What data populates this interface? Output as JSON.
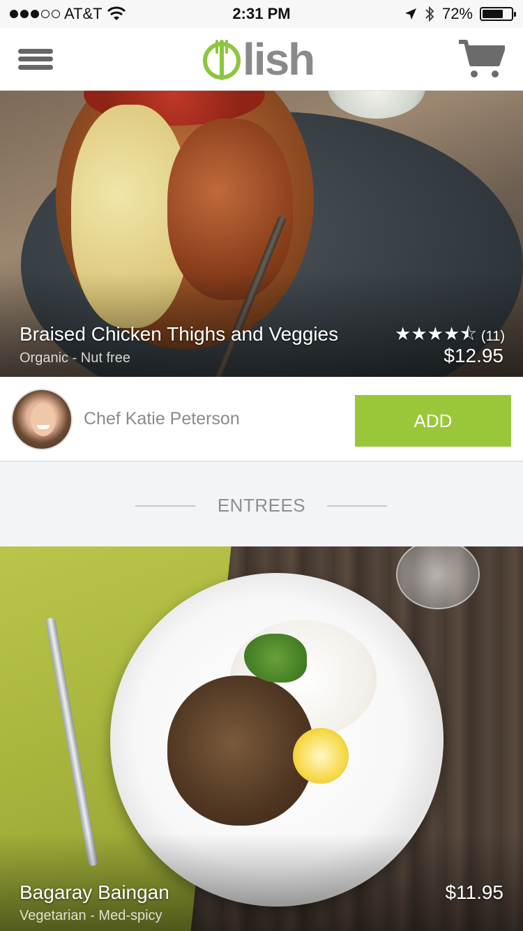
{
  "status_bar": {
    "carrier": "AT&T",
    "time": "2:31 PM",
    "battery_percent": "72%",
    "battery_level": 0.72,
    "signal_bars_filled": 3,
    "signal_bars_total": 5,
    "icons": [
      "wifi-icon",
      "location-arrow-icon",
      "bluetooth-icon",
      "battery-icon"
    ]
  },
  "header": {
    "logo_text": "lish",
    "menu_icon": "hamburger-menu-icon",
    "cart_icon": "shopping-cart-icon"
  },
  "colors": {
    "accent_green": "#9ac73a",
    "logo_green": "#8cc63f",
    "text_gray": "#8a8a8a"
  },
  "featured": {
    "title": "Braised Chicken Thighs and Veggies",
    "tags": "Organic - Nut free",
    "rating_value": 4.5,
    "rating_max": 5,
    "rating_count": "(11)",
    "price": "$12.95",
    "chef_name": "Chef Katie Peterson",
    "add_label": "ADD"
  },
  "section": {
    "title": "ENTREES"
  },
  "entree": {
    "title": "Bagaray Baingan",
    "tags": "Vegetarian - Med-spicy",
    "price": "$11.95"
  }
}
